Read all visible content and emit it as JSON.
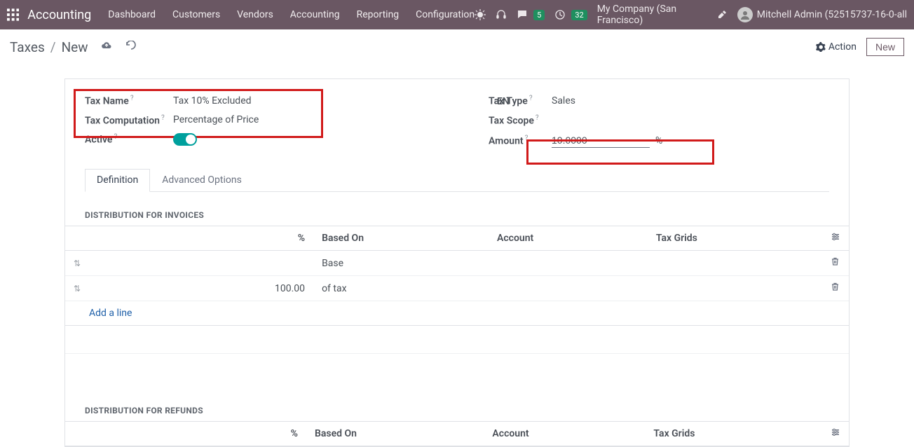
{
  "header": {
    "app_name": "Accounting",
    "menu": [
      "Dashboard",
      "Customers",
      "Vendors",
      "Accounting",
      "Reporting",
      "Configuration"
    ],
    "chat_badge": "5",
    "clock_badge": "32",
    "company": "My Company (San Francisco)",
    "user": "Mitchell Admin (52515737-16-0-all"
  },
  "breadcrumb": {
    "root": "Taxes",
    "current": "New",
    "action_label": "Action",
    "new_label": "New"
  },
  "form": {
    "tax_name_label": "Tax Name",
    "tax_name_value": "Tax 10% Excluded",
    "tax_computation_label": "Tax Computation",
    "tax_computation_value": "Percentage of Price",
    "active_label": "Active",
    "lang": "EN",
    "tax_type_label": "Tax Type",
    "tax_type_value": "Sales",
    "tax_scope_label": "Tax Scope",
    "amount_label": "Amount",
    "amount_value": "10.0000",
    "amount_suffix": "%"
  },
  "tabs": {
    "definition": "Definition",
    "advanced": "Advanced Options"
  },
  "sections": {
    "invoices_title": "DISTRIBUTION FOR INVOICES",
    "refunds_title": "DISTRIBUTION FOR REFUNDS",
    "cols": {
      "pct": "%",
      "based_on": "Based On",
      "account": "Account",
      "tax_grids": "Tax Grids"
    },
    "rows": [
      {
        "pct": "",
        "based_on": "Base"
      },
      {
        "pct": "100.00",
        "based_on": "of tax"
      }
    ],
    "add_line": "Add a line"
  }
}
